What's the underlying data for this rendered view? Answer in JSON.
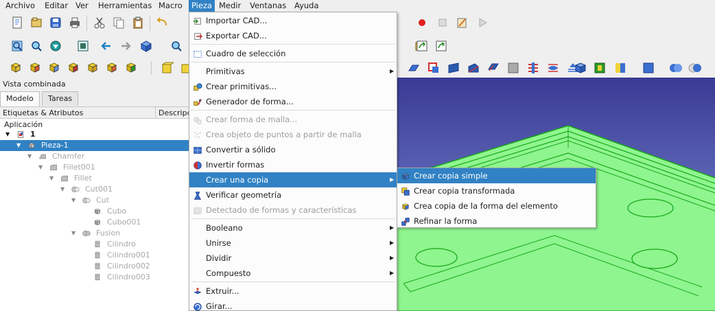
{
  "menubar": {
    "items": [
      "Archivo",
      "Editar",
      "Ver",
      "Herramientas",
      "Macro",
      "Pieza",
      "Medir",
      "Ventanas",
      "Ayuda"
    ],
    "active": "Pieza"
  },
  "combo_view": {
    "title": "Vista combinada",
    "tabs": [
      "Modelo",
      "Tareas"
    ],
    "active_tab": "Modelo",
    "columns": [
      "Etiquetas & Atributos",
      "Descripción"
    ],
    "group_label": "Aplicación"
  },
  "tree": [
    {
      "label": "1",
      "level": 0,
      "expanded": true,
      "icon": "document-icon",
      "selected": false,
      "dim": false,
      "bold": true
    },
    {
      "label": "Pieza-1",
      "level": 1,
      "expanded": true,
      "icon": "part-icon",
      "selected": true,
      "dim": false
    },
    {
      "label": "Chamfer",
      "level": 2,
      "expanded": true,
      "icon": "chamfer-icon",
      "selected": false,
      "dim": true
    },
    {
      "label": "Fillet001",
      "level": 3,
      "expanded": true,
      "icon": "fillet-icon",
      "selected": false,
      "dim": true
    },
    {
      "label": "Fillet",
      "level": 4,
      "expanded": true,
      "icon": "fillet-icon",
      "selected": false,
      "dim": true
    },
    {
      "label": "Cut001",
      "level": 5,
      "expanded": true,
      "icon": "cut-icon",
      "selected": false,
      "dim": true
    },
    {
      "label": "Cut",
      "level": 6,
      "expanded": true,
      "icon": "cut-icon",
      "selected": false,
      "dim": true
    },
    {
      "label": "Cubo",
      "level": 7,
      "expanded": null,
      "icon": "cube-icon",
      "selected": false,
      "dim": true
    },
    {
      "label": "Cubo001",
      "level": 7,
      "expanded": null,
      "icon": "cube-icon",
      "selected": false,
      "dim": true
    },
    {
      "label": "Fusion",
      "level": 6,
      "expanded": true,
      "icon": "fusion-icon",
      "selected": false,
      "dim": true
    },
    {
      "label": "Cilindro",
      "level": 7,
      "expanded": null,
      "icon": "cylinder-icon",
      "selected": false,
      "dim": true
    },
    {
      "label": "Cilindro001",
      "level": 7,
      "expanded": null,
      "icon": "cylinder-icon",
      "selected": false,
      "dim": true
    },
    {
      "label": "Cilindro002",
      "level": 7,
      "expanded": null,
      "icon": "cylinder-icon",
      "selected": false,
      "dim": true
    },
    {
      "label": "Cilindro003",
      "level": 7,
      "expanded": null,
      "icon": "cylinder-icon",
      "selected": false,
      "dim": true
    }
  ],
  "pieza_menu": [
    {
      "label": "Importar CAD...",
      "icon": "import-cad-icon",
      "enabled": true,
      "submenu": false
    },
    {
      "label": "Exportar CAD...",
      "icon": "export-cad-icon",
      "enabled": true,
      "submenu": false
    },
    {
      "separator": true
    },
    {
      "label": "Cuadro de selección",
      "icon": "box-selection-icon",
      "enabled": true,
      "submenu": false
    },
    {
      "separator": true
    },
    {
      "label": "Primitivas",
      "icon": "",
      "enabled": true,
      "submenu": true
    },
    {
      "label": "Crear primitivas...",
      "icon": "create-primitives-icon",
      "enabled": true,
      "submenu": false
    },
    {
      "label": "Generador de forma...",
      "icon": "shape-builder-icon",
      "enabled": true,
      "submenu": false
    },
    {
      "separator": true
    },
    {
      "label": "Crear forma de malla...",
      "icon": "mesh-shape-icon",
      "enabled": false,
      "submenu": false
    },
    {
      "label": "Crea objeto de puntos a partir de malla",
      "icon": "points-from-mesh-icon",
      "enabled": false,
      "submenu": false
    },
    {
      "label": "Convertir a sólido",
      "icon": "convert-solid-icon",
      "enabled": true,
      "submenu": false
    },
    {
      "label": "Invertir formas",
      "icon": "reverse-shapes-icon",
      "enabled": true,
      "submenu": false
    },
    {
      "label": "Crear una copia",
      "icon": "",
      "enabled": true,
      "submenu": true,
      "highlighted": true
    },
    {
      "label": "Verificar geometría",
      "icon": "check-geometry-icon",
      "enabled": true,
      "submenu": false
    },
    {
      "label": "Detectado de formas y características",
      "icon": "defeaturing-icon",
      "enabled": false,
      "submenu": false
    },
    {
      "separator": true
    },
    {
      "label": "Booleano",
      "icon": "",
      "enabled": true,
      "submenu": true
    },
    {
      "label": "Unirse",
      "icon": "",
      "enabled": true,
      "submenu": true
    },
    {
      "label": "Dividir",
      "icon": "",
      "enabled": true,
      "submenu": true
    },
    {
      "label": "Compuesto",
      "icon": "",
      "enabled": true,
      "submenu": true
    },
    {
      "separator": true
    },
    {
      "label": "Extruir...",
      "icon": "extrude-icon",
      "enabled": true,
      "submenu": false
    },
    {
      "label": "Girar...",
      "icon": "revolve-icon",
      "enabled": true,
      "submenu": false
    }
  ],
  "copy_submenu": [
    {
      "label": "Crear copia simple",
      "icon": "simple-copy-icon",
      "highlighted": true
    },
    {
      "label": "Crear copia transformada",
      "icon": "transformed-copy-icon",
      "highlighted": false
    },
    {
      "label": "Crea copia de la forma del elemento",
      "icon": "element-copy-icon",
      "highlighted": false
    },
    {
      "label": "Refinar la forma",
      "icon": "refine-shape-icon",
      "highlighted": false
    }
  ],
  "colors": {
    "highlight": "#3182c4",
    "model_green": "#8ff58f",
    "model_edge": "#18a818",
    "view_bg_top": "#3a3a94",
    "view_bg_bottom": "#8a93cf"
  }
}
